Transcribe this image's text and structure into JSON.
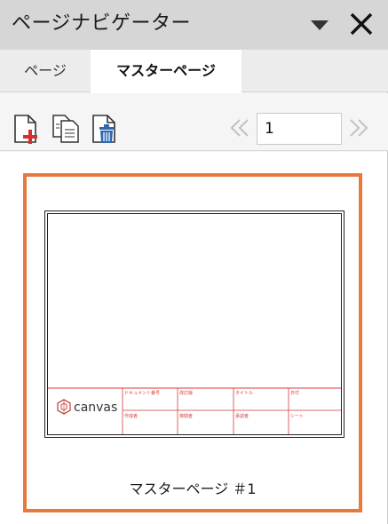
{
  "panel": {
    "title": "ページナビゲーター"
  },
  "tabs": [
    {
      "label": "ページ",
      "active": false
    },
    {
      "label": "マスターページ",
      "active": true
    }
  ],
  "toolbar": {
    "current_page": "1"
  },
  "master_pages": [
    {
      "label": "マスターページ ＃1",
      "selected": true,
      "title_block": {
        "logo_text": "canvas",
        "cells": [
          "ドキュメント番号",
          "改訂版",
          "タイトル",
          "日付",
          "作成者",
          "検閲者",
          "承認者",
          "シート"
        ]
      }
    }
  ],
  "colors": {
    "selection_border": "#e8783e",
    "title_block_lines": "#d93a3a",
    "delete_icon": "#2f67b1",
    "add_icon": "#d32f2f"
  }
}
